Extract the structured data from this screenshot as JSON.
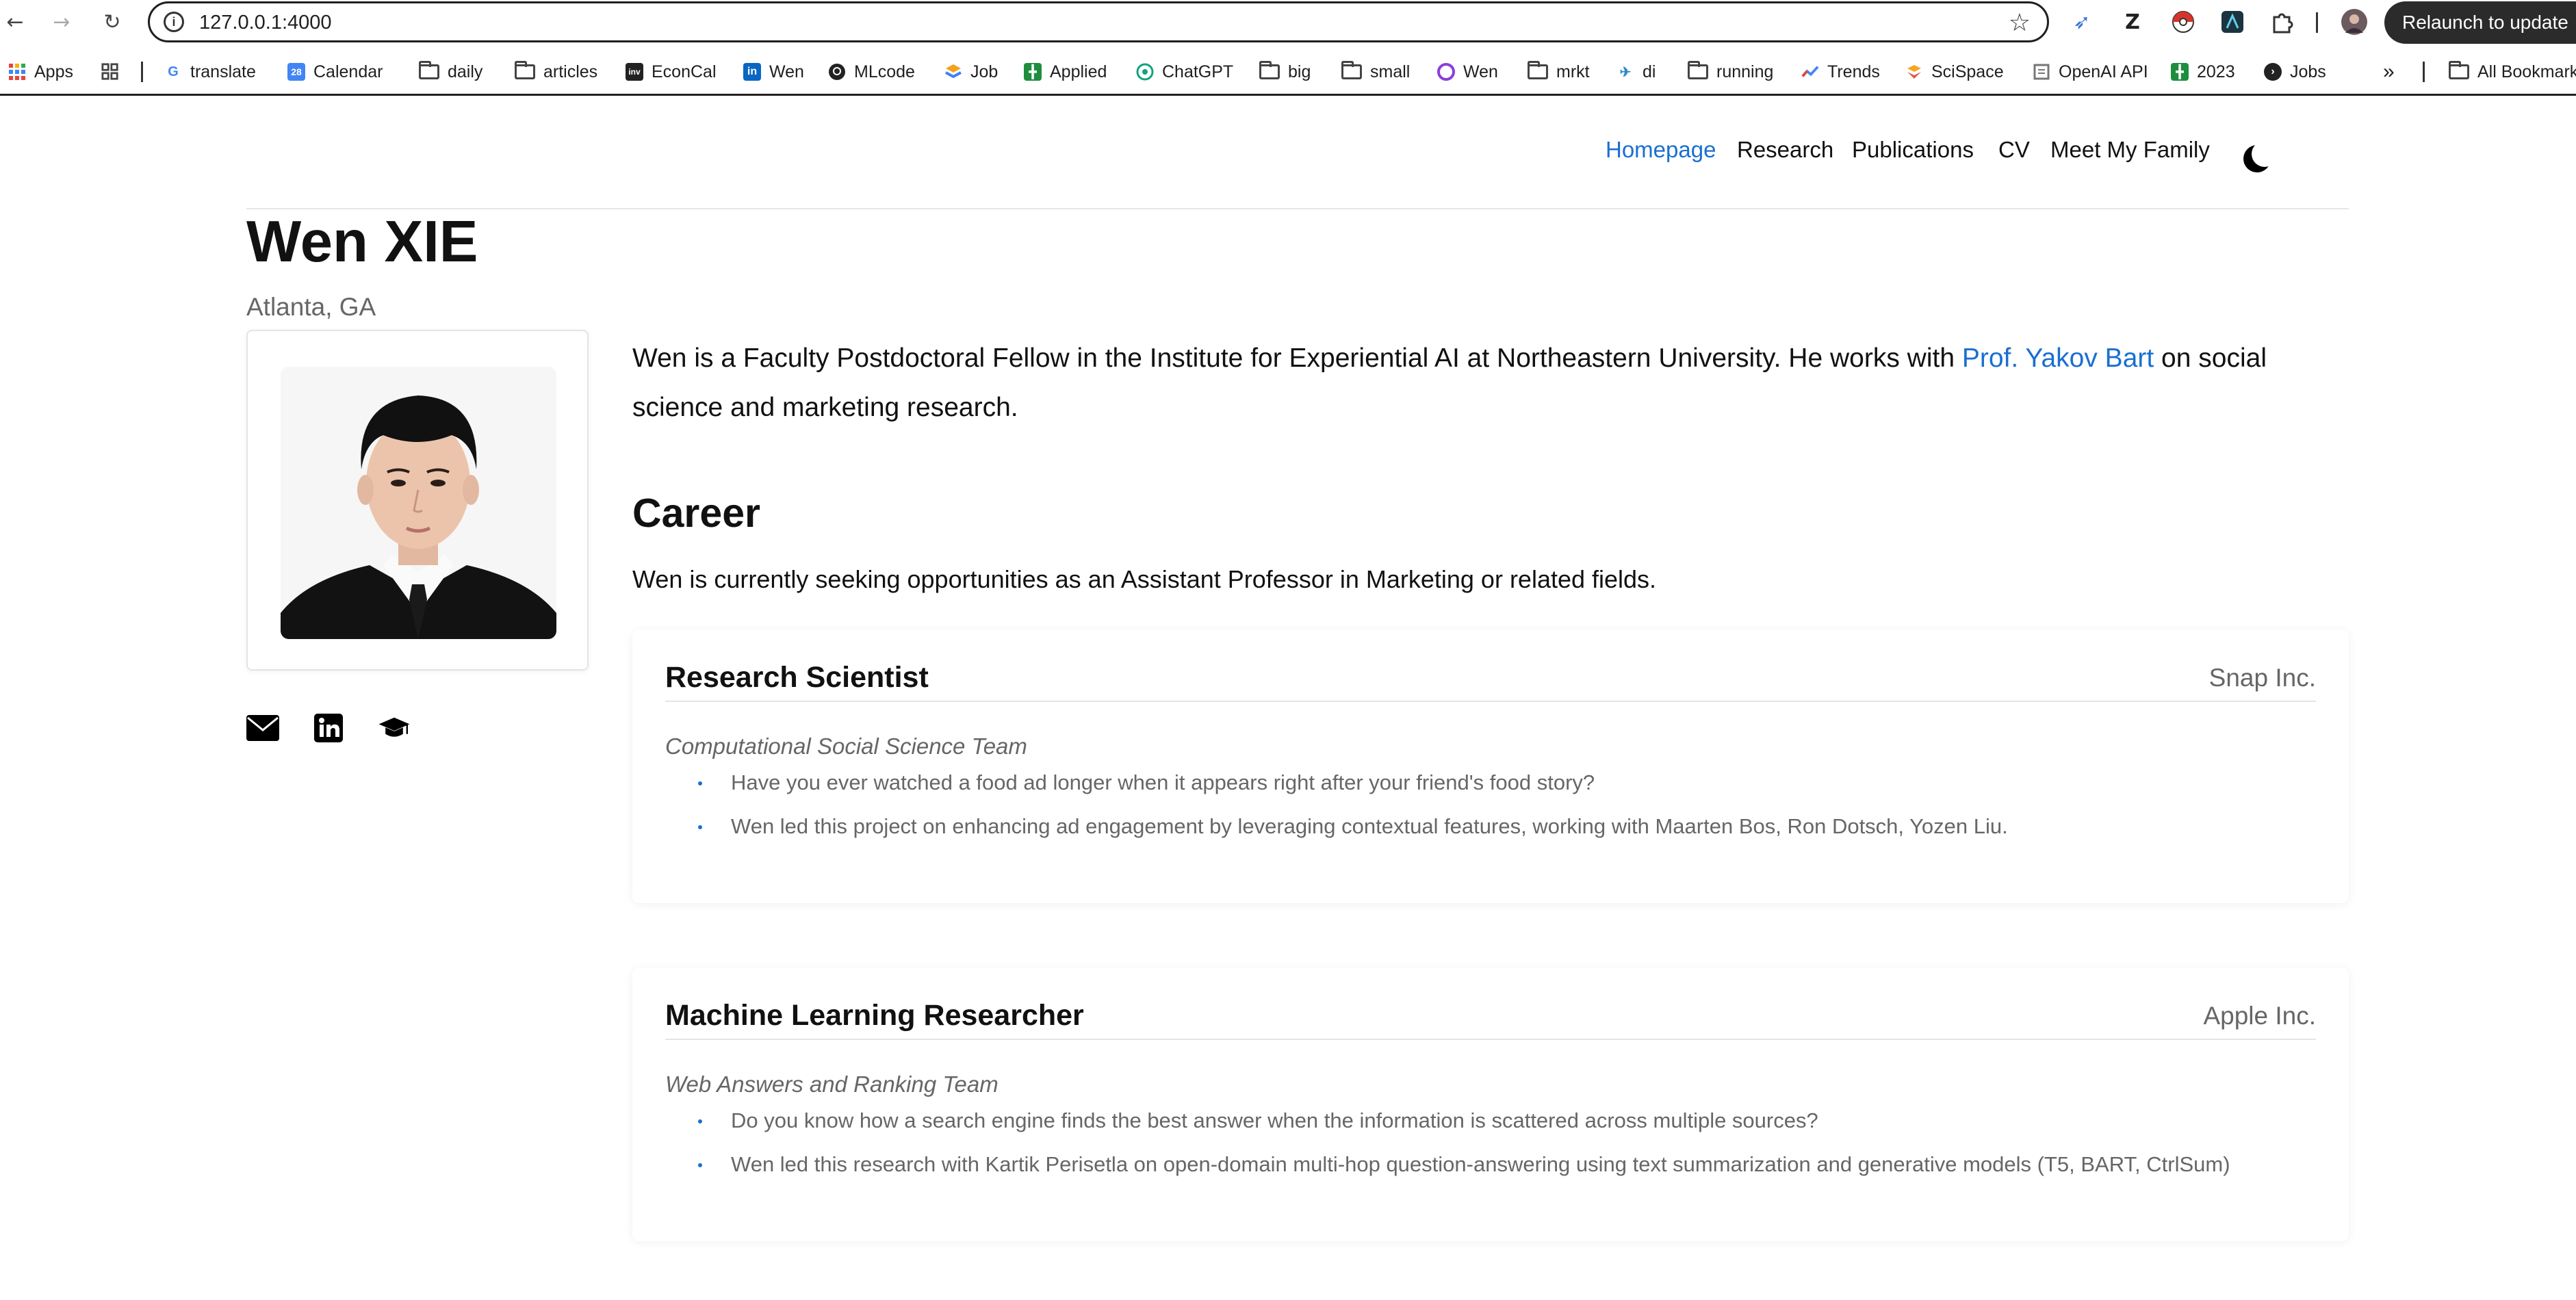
{
  "browser": {
    "url": "127.0.0.1:4000",
    "relaunch_label": "Relaunch to update",
    "bookmarks": [
      {
        "label": "Apps",
        "icon": "apps-grid-icon"
      },
      {
        "label": "translate",
        "icon": "google-icon"
      },
      {
        "label": "Calendar",
        "icon": "calendar-icon"
      },
      {
        "label": "daily",
        "icon": "folder-icon"
      },
      {
        "label": "articles",
        "icon": "folder-icon"
      },
      {
        "label": "EconCal",
        "icon": "investing-icon"
      },
      {
        "label": "Wen",
        "icon": "linkedin-icon"
      },
      {
        "label": "MLcode",
        "icon": "github-icon"
      },
      {
        "label": "Job",
        "icon": "job-icon"
      },
      {
        "label": "Applied",
        "icon": "sheets-icon"
      },
      {
        "label": "ChatGPT",
        "icon": "chatgpt-icon"
      },
      {
        "label": "big",
        "icon": "folder-icon"
      },
      {
        "label": "small",
        "icon": "folder-icon"
      },
      {
        "label": "Wen",
        "icon": "purple-app-icon"
      },
      {
        "label": "mrkt",
        "icon": "folder-icon"
      },
      {
        "label": "di",
        "icon": "di-icon"
      },
      {
        "label": "running",
        "icon": "folder-icon"
      },
      {
        "label": "Trends",
        "icon": "trends-icon"
      },
      {
        "label": "SciSpace",
        "icon": "scispace-icon"
      },
      {
        "label": "OpenAI API",
        "icon": "openai-icon"
      },
      {
        "label": "2023",
        "icon": "sheets-icon"
      },
      {
        "label": "Jobs",
        "icon": "jobs-icon"
      },
      {
        "label": "All Bookmarks",
        "icon": "folder-icon"
      }
    ]
  },
  "site_nav": {
    "homepage": "Homepage",
    "research": "Research",
    "publications": "Publications",
    "cv": "CV",
    "family": "Meet My Family"
  },
  "profile": {
    "name": "Wen XIE",
    "location": "Atlanta, GA"
  },
  "intro": {
    "before": "Wen is a Faculty Postdoctoral Fellow in the Institute for Experiential AI at Northeastern University. He works with ",
    "link": "Prof. Yakov Bart",
    "after": " on social science and marketing research."
  },
  "career": {
    "heading": "Career",
    "text": "Wen is currently seeking opportunities as an Assistant Professor in Marketing or related fields.",
    "jobs": [
      {
        "title": "Research Scientist",
        "company": "Snap Inc.",
        "team": "Computational Social Science Team",
        "bullets": [
          "Have you ever watched a food ad longer when it appears right after your friend's food story?",
          "Wen led this project on enhancing ad engagement by leveraging contextual features, working with Maarten Bos, Ron Dotsch, Yozen Liu."
        ]
      },
      {
        "title": "Machine Learning Researcher",
        "company": "Apple Inc.",
        "team": "Web Answers and Ranking Team",
        "bullets": [
          "Do you know how a search engine finds the best answer when the information is scattered across multiple sources?",
          "Wen led this research with Kartik Perisetla on open-domain multi-hop question-answering using text summarization and generative models (T5, BART, CtrlSum)"
        ]
      }
    ]
  }
}
